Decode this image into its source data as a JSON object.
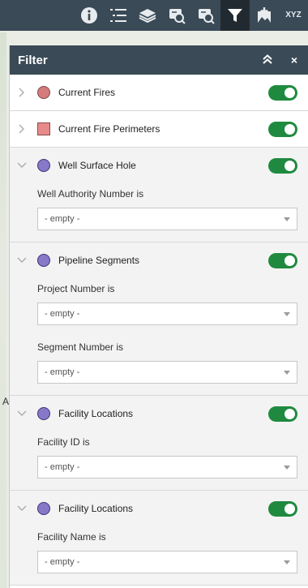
{
  "colors": {
    "toolbar": "#3a4a56",
    "toggle_on": "#1f8a3f",
    "fire_symbol": "#d67b7b",
    "perimeter_symbol": "#e68a8a",
    "point_symbol": "#8878c8"
  },
  "toolbar": {
    "tools": [
      {
        "icon": "info-icon"
      },
      {
        "icon": "layer-list-icon"
      },
      {
        "icon": "layers-icon"
      },
      {
        "icon": "query-icon"
      },
      {
        "icon": "query-icon-2"
      },
      {
        "icon": "filter-icon",
        "active": true
      },
      {
        "icon": "add-data-icon"
      },
      {
        "icon": "coordinate-conversion-icon",
        "label": "XYZ"
      }
    ]
  },
  "panel": {
    "title": "Filter",
    "collapse_icon": "double-chevron-up-icon",
    "close_label": "×"
  },
  "layers": [
    {
      "name": "Current Fires",
      "symbol": "circle",
      "color": "#d67b7b",
      "expanded": false,
      "enabled": true,
      "fields": []
    },
    {
      "name": "Current Fire Perimeters",
      "symbol": "square",
      "color": "#e68a8a",
      "expanded": false,
      "enabled": true,
      "fields": []
    },
    {
      "name": "Well Surface Hole",
      "symbol": "circle",
      "color": "#8878c8",
      "expanded": true,
      "enabled": true,
      "fields": [
        {
          "label": "Well Authority Number is",
          "value": "- empty -"
        }
      ]
    },
    {
      "name": "Pipeline Segments",
      "symbol": "circle",
      "color": "#8878c8",
      "expanded": true,
      "enabled": true,
      "fields": [
        {
          "label": "Project Number is",
          "value": "- empty -"
        },
        {
          "label": "Segment Number is",
          "value": "- empty -"
        }
      ]
    },
    {
      "name": "Facility Locations",
      "symbol": "circle",
      "color": "#8878c8",
      "expanded": true,
      "enabled": true,
      "fields": [
        {
          "label": "Facility ID is",
          "value": "- empty -"
        }
      ]
    },
    {
      "name": "Facility Locations",
      "symbol": "circle",
      "color": "#8878c8",
      "expanded": true,
      "enabled": true,
      "fields": [
        {
          "label": "Facility Name is",
          "value": "- empty -"
        }
      ]
    }
  ]
}
